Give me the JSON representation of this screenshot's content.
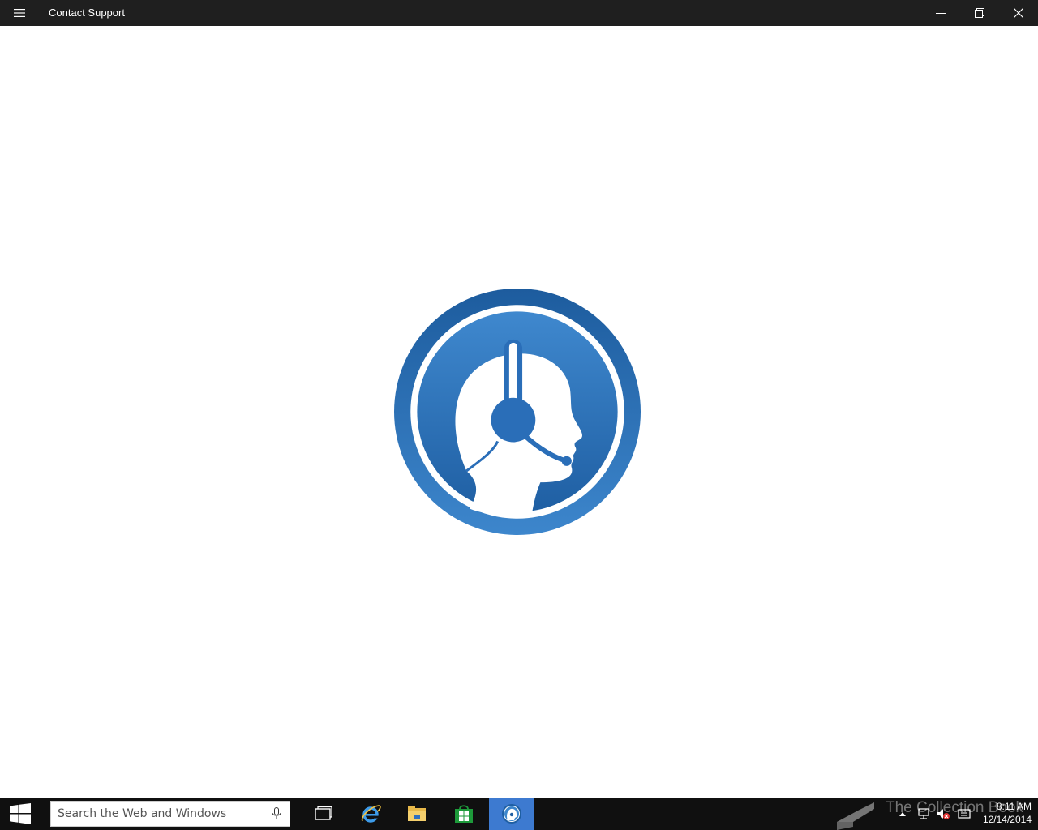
{
  "window": {
    "title": "Contact Support"
  },
  "icons": {
    "menu": "hamburger-menu-icon",
    "minimize": "minimize-icon",
    "maximize": "restore-icon",
    "close": "close-icon",
    "logo": "headset-support-agent-logo",
    "start": "windows-logo-icon",
    "mic": "microphone-icon",
    "task_view": "task-view-icon",
    "ie": "internet-explorer-icon",
    "explorer": "file-explorer-icon",
    "store": "store-icon",
    "support": "contact-support-icon",
    "watermark": "book-icon",
    "tray_chevron": "chevron-up-icon",
    "network": "network-icon",
    "volume": "volume-muted-icon",
    "messages": "action-center-icon"
  },
  "colors": {
    "titlebar": "#1f1f1f",
    "taskbar": "#101010",
    "accent": "#3d7ad0",
    "logo_blue": "#2a6eb8"
  },
  "taskbar": {
    "search_placeholder": "Search the Web and Windows",
    "watermark_text": "The Collection Book",
    "clock_time": "8:11 AM",
    "clock_date": "12/14/2014"
  }
}
